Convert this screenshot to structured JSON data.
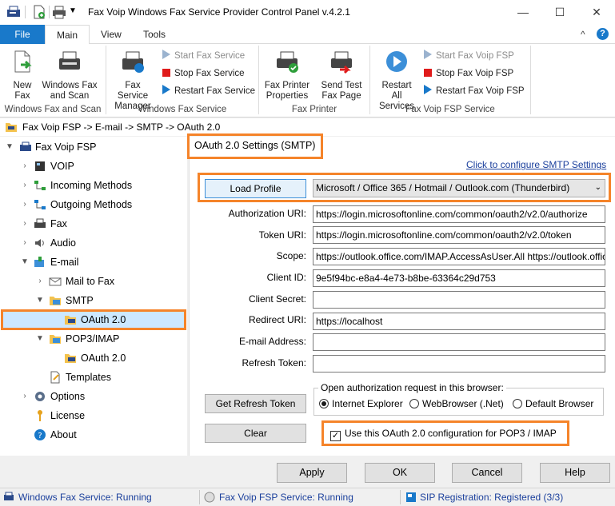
{
  "window": {
    "title": "Fax Voip Windows Fax Service Provider Control Panel v.4.2.1",
    "minimize": "—",
    "maximize": "☐",
    "close": "✕"
  },
  "ribbon_tabs": [
    {
      "label": "File"
    },
    {
      "label": "Main"
    },
    {
      "label": "View"
    },
    {
      "label": "Tools"
    }
  ],
  "ribbon": {
    "collapse_glyph": "^",
    "help_glyph": "?",
    "groups": {
      "windows_fax_scan": {
        "label": "Windows Fax and Scan",
        "new_fax": "New Fax",
        "fax_scan": "Windows Fax and Scan"
      },
      "windows_fax_service": {
        "label": "Windows Fax Service",
        "service_manager": "Fax Service Manager",
        "start": "Start Fax Service",
        "stop": "Stop Fax Service",
        "restart": "Restart Fax Service"
      },
      "fax_printer": {
        "label": "Fax Printer",
        "printer_properties": "Fax Printer Properties",
        "send_test": "Send Test Fax Page"
      },
      "fsp_service": {
        "label": "Fax Voip FSP Service",
        "restart_all": "Restart All Services",
        "start": "Start Fax Voip FSP",
        "stop": "Stop Fax Voip FSP",
        "restart": "Restart Fax Voip FSP"
      }
    }
  },
  "breadcrumb": "Fax Voip FSP -> E-mail -> SMTP -> OAuth 2.0",
  "tree": {
    "root": "Fax Voip FSP",
    "voip": "VOIP",
    "incoming": "Incoming Methods",
    "outgoing": "Outgoing Methods",
    "fax": "Fax",
    "audio": "Audio",
    "email": "E-mail",
    "mail_to_fax": "Mail to Fax",
    "smtp": "SMTP",
    "smtp_oauth": "OAuth 2.0",
    "pop3": "POP3/IMAP",
    "pop3_oauth": "OAuth 2.0",
    "templates": "Templates",
    "options": "Options",
    "license": "License",
    "about": "About"
  },
  "panel": {
    "header": "OAuth 2.0 Settings (SMTP)",
    "smtp_link": "Click to configure SMTP Settings",
    "load_profile": "Load Profile",
    "profile_selected": "Microsoft / Office 365 / Hotmail / Outlook.com (Thunderbird)",
    "fields": {
      "auth_uri": {
        "label": "Authorization URI:",
        "value": "https://login.microsoftonline.com/common/oauth2/v2.0/authorize"
      },
      "token_uri": {
        "label": "Token URI:",
        "value": "https://login.microsoftonline.com/common/oauth2/v2.0/token"
      },
      "scope": {
        "label": "Scope:",
        "value": "https://outlook.office.com/IMAP.AccessAsUser.All https://outlook.office.com/SMTP.Send offline_access"
      },
      "client_id": {
        "label": "Client ID:",
        "value": "9e5f94bc-e8a4-4e73-b8be-63364c29d753"
      },
      "client_secret": {
        "label": "Client Secret:",
        "value": ""
      },
      "redirect_uri": {
        "label": "Redirect URI:",
        "value": "https://localhost"
      },
      "email": {
        "label": "E-mail Address:",
        "value": ""
      },
      "refresh_token": {
        "label": "Refresh Token:",
        "value": ""
      }
    },
    "browser_group": {
      "label": "Open authorization request in this browser:",
      "options": [
        "Internet Explorer",
        "WebBrowser (.Net)",
        "Default Browser"
      ],
      "selected": "Internet Explorer"
    },
    "get_refresh_token": "Get Refresh Token",
    "clear": "Clear",
    "use_pop3": {
      "label": "Use this OAuth 2.0 configuration for POP3 / IMAP",
      "checked": true,
      "glyph": "✓"
    }
  },
  "buttons": {
    "apply": "Apply",
    "ok": "OK",
    "cancel": "Cancel",
    "help": "Help"
  },
  "status": {
    "fax_service": "Windows Fax Service: Running",
    "fsp_service": "Fax Voip FSP Service: Running",
    "sip": "SIP Registration: Registered (3/3)"
  },
  "colors": {
    "accent": "#1979ca",
    "highlight": "#f5842a",
    "link": "#1a3f9c",
    "selection": "#cce8ff"
  }
}
